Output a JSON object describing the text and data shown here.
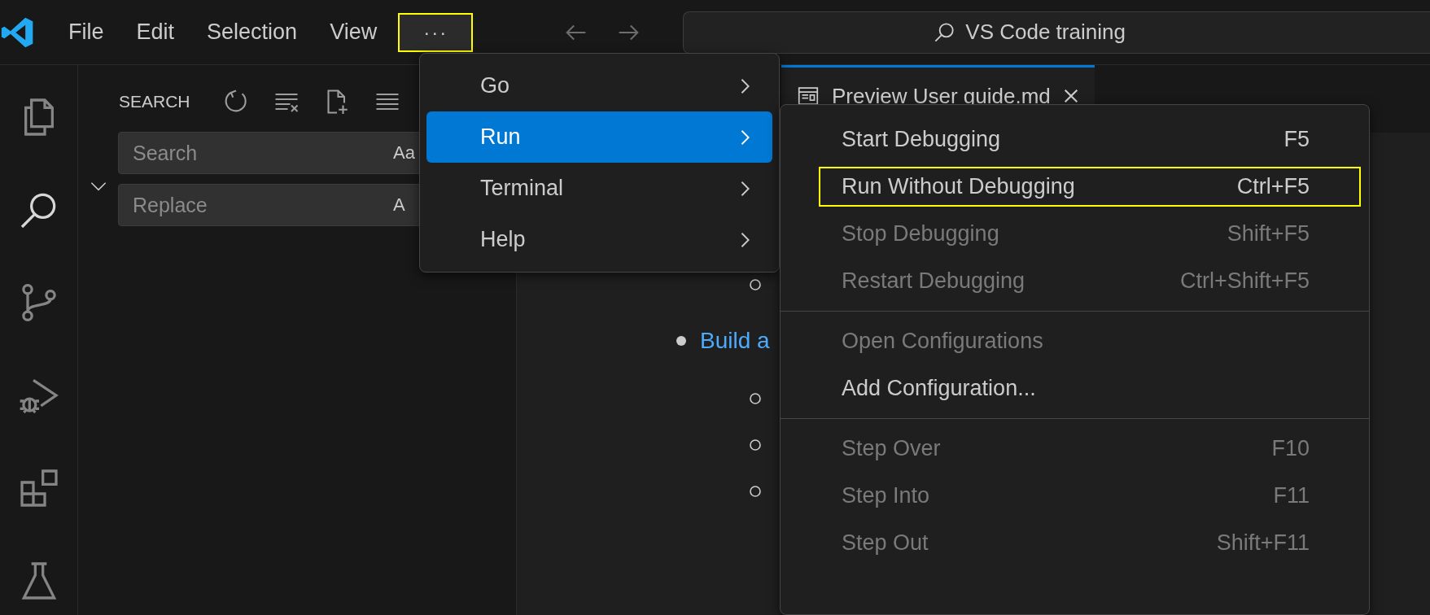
{
  "title_bar": {
    "menus": [
      {
        "label": "File"
      },
      {
        "label": "Edit"
      },
      {
        "label": "Selection"
      },
      {
        "label": "View"
      }
    ],
    "overflow": {
      "label": "···",
      "highlighted": true
    },
    "command_center": {
      "text": "VS Code training"
    }
  },
  "activity_bar": {
    "items": [
      {
        "kind": "explorer",
        "selected": false
      },
      {
        "kind": "search",
        "selected": true
      },
      {
        "kind": "source-control",
        "selected": false
      },
      {
        "kind": "run-debug",
        "selected": false
      },
      {
        "kind": "extensions",
        "selected": false
      },
      {
        "kind": "testing",
        "selected": false
      }
    ]
  },
  "sidebar": {
    "title": "SEARCH",
    "search": {
      "placeholder": "Search",
      "toggle": "Aa"
    },
    "replace": {
      "placeholder": "Replace",
      "toggle": "A"
    },
    "expanded": true
  },
  "editor": {
    "tabs": [
      {
        "label": "Preview User guide.md",
        "selected": true
      }
    ],
    "outline": [
      {
        "kind": "sub"
      },
      {
        "kind": "main",
        "text": "Build a"
      },
      {
        "kind": "sub"
      },
      {
        "kind": "sub"
      },
      {
        "kind": "sub"
      }
    ]
  },
  "menu": {
    "items": [
      {
        "label": "Go",
        "selected": false
      },
      {
        "label": "Run",
        "selected": true
      },
      {
        "label": "Terminal",
        "selected": false
      },
      {
        "label": "Help",
        "selected": false
      }
    ]
  },
  "submenu": {
    "groups": [
      [
        {
          "label": "Start Debugging",
          "shortcut": "F5",
          "disabled": false,
          "highlighted": false
        },
        {
          "label": "Run Without Debugging",
          "shortcut": "Ctrl+F5",
          "disabled": false,
          "highlighted": true
        },
        {
          "label": "Stop Debugging",
          "shortcut": "Shift+F5",
          "disabled": true,
          "highlighted": false
        },
        {
          "label": "Restart Debugging",
          "shortcut": "Ctrl+Shift+F5",
          "disabled": true,
          "highlighted": false
        }
      ],
      [
        {
          "label": "Open Configurations",
          "disabled": true,
          "highlighted": false
        },
        {
          "label": "Add Configuration...",
          "disabled": false,
          "highlighted": false
        }
      ],
      [
        {
          "label": "Step Over",
          "shortcut": "F10",
          "disabled": true,
          "highlighted": false
        },
        {
          "label": "Step Into",
          "shortcut": "F11",
          "disabled": true,
          "highlighted": false
        },
        {
          "label": "Step Out",
          "shortcut": "Shift+F11",
          "disabled": true,
          "highlighted": false
        }
      ]
    ]
  }
}
